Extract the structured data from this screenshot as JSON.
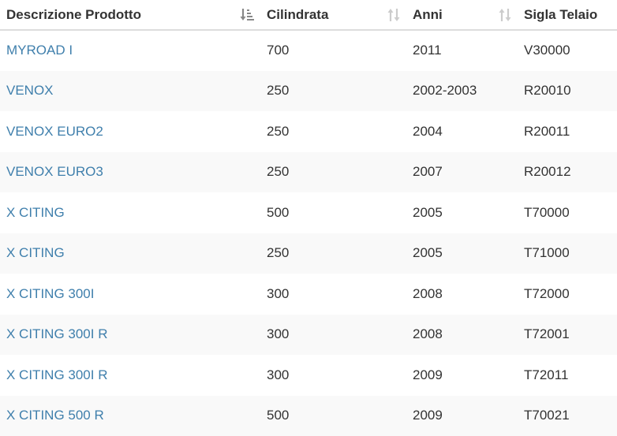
{
  "columns": [
    {
      "label": "Descrizione Prodotto",
      "sort": "sort-amount-asc-icon"
    },
    {
      "label": "Cilindrata",
      "sort": "sort-icon"
    },
    {
      "label": "Anni",
      "sort": "sort-icon"
    },
    {
      "label": "Sigla Telaio",
      "sort": "none"
    }
  ],
  "colors": {
    "link": "#3f7fac",
    "text": "#333333",
    "stripe": "#f9f9f9",
    "active_sort_icon": "#888888",
    "inactive_sort_icon": "#cccccc"
  },
  "rows": [
    {
      "descrizione": "MYROAD I",
      "cilindrata": "700",
      "anni": "2011",
      "sigla": "V30000"
    },
    {
      "descrizione": "VENOX",
      "cilindrata": "250",
      "anni": "2002-2003",
      "sigla": "R20010"
    },
    {
      "descrizione": "VENOX EURO2",
      "cilindrata": "250",
      "anni": "2004",
      "sigla": "R20011"
    },
    {
      "descrizione": "VENOX EURO3",
      "cilindrata": "250",
      "anni": "2007",
      "sigla": "R20012"
    },
    {
      "descrizione": "X CITING",
      "cilindrata": "500",
      "anni": "2005",
      "sigla": "T70000"
    },
    {
      "descrizione": "X CITING",
      "cilindrata": "250",
      "anni": "2005",
      "sigla": "T71000"
    },
    {
      "descrizione": "X CITING 300I",
      "cilindrata": "300",
      "anni": "2008",
      "sigla": "T72000"
    },
    {
      "descrizione": "X CITING 300I R",
      "cilindrata": "300",
      "anni": "2008",
      "sigla": "T72001"
    },
    {
      "descrizione": "X CITING 300I R",
      "cilindrata": "300",
      "anni": "2009",
      "sigla": "T72011"
    },
    {
      "descrizione": "X CITING 500 R",
      "cilindrata": "500",
      "anni": "2009",
      "sigla": "T70021"
    }
  ]
}
